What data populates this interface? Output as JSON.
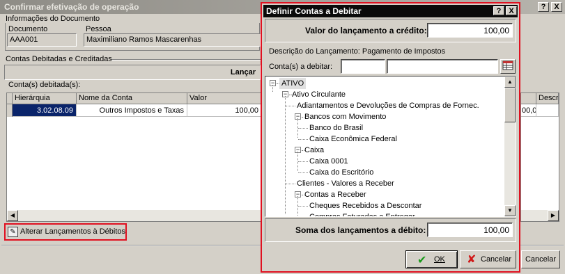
{
  "background_window": {
    "title": "Confirmar efetivação de operação",
    "help_button": "?",
    "close_button": "X",
    "document_info": {
      "group_label": "Informações do Documento",
      "documento_label": "Documento",
      "documento_value": "AAA001",
      "pessoa_label": "Pessoa",
      "pessoa_value": "Maximiliano Ramos Mascarenhas"
    },
    "contas_group_label": "Contas Debitadas e Creditadas",
    "lancamentos_header": "Lançar",
    "contas_debitadas_label": "Conta(s) debitada(s):",
    "grid": {
      "columns": [
        "Hierárquia",
        "Nome da Conta",
        "Valor"
      ],
      "rows": [
        {
          "hierarquia": "3.02.08.09",
          "nome": "Outros Impostos e Taxas",
          "valor": "100,00"
        }
      ]
    },
    "right_grid": {
      "column": "Descr",
      "value": "00,00"
    },
    "alterar_button": "Alterar Lançamentos à Débitos",
    "cancelar_button": "Cancelar"
  },
  "dialog": {
    "title": "Definir Contas a Debitar",
    "help_button": "?",
    "close_button": "X",
    "valor_label": "Valor do lançamento a crédito:",
    "valor_value": "100,00",
    "descricao_text": "Descrição do Lançamento: Pagamento de Impostos",
    "conta_label": "Conta(s) a debitar:",
    "conta_code_value": "",
    "conta_name_value": "",
    "tree": [
      {
        "label": "ATIVO",
        "level": 0,
        "toggle": "−"
      },
      {
        "label": "Ativo Circulante",
        "level": 1,
        "toggle": "−"
      },
      {
        "label": "Adiantamentos e Devoluções de Compras de Fornec.",
        "level": 2,
        "toggle": ""
      },
      {
        "label": "Bancos com Movimento",
        "level": 2,
        "toggle": "−"
      },
      {
        "label": "Banco do Brasil",
        "level": 3,
        "toggle": ""
      },
      {
        "label": "Caixa Econômica Federal",
        "level": 3,
        "toggle": ""
      },
      {
        "label": "Caixa",
        "level": 2,
        "toggle": "−"
      },
      {
        "label": "Caixa 0001",
        "level": 3,
        "toggle": ""
      },
      {
        "label": "Caixa do Escritório",
        "level": 3,
        "toggle": ""
      },
      {
        "label": "Clientes - Valores a Receber",
        "level": 2,
        "toggle": ""
      },
      {
        "label": "Contas a Receber",
        "level": 2,
        "toggle": "−"
      },
      {
        "label": "Cheques Recebidos a Descontar",
        "level": 3,
        "toggle": ""
      },
      {
        "label": "Compras Faturadas a Entregar",
        "level": 3,
        "toggle": ""
      }
    ],
    "soma_label": "Soma dos lançamentos a débito:",
    "soma_value": "100,00",
    "ok_button": "OK",
    "cancelar_button": "Cancelar",
    "colors": {
      "highlight_red": "#e01020",
      "selection_blue": "#0a246a"
    }
  }
}
